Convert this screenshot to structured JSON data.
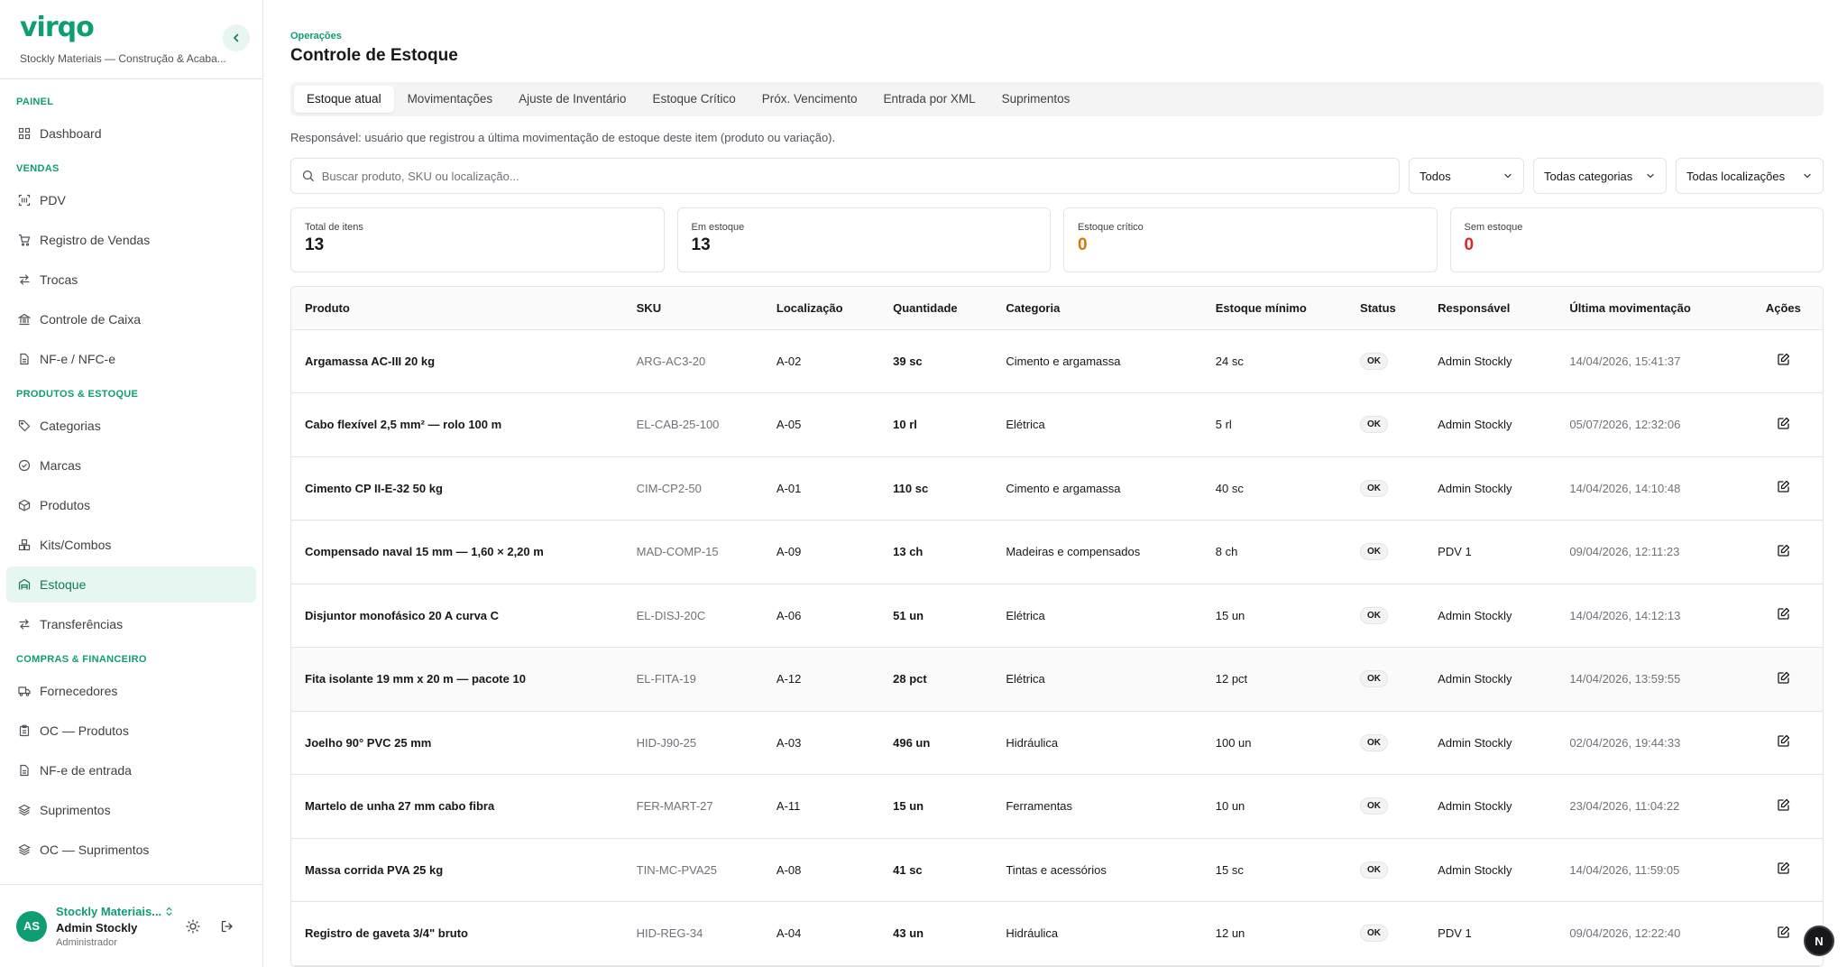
{
  "brand": {
    "logo": "virqo",
    "company": "Stockly Materiais — Construção & Acaba..."
  },
  "sidebar": {
    "groups": [
      {
        "title": "PAINEL",
        "items": [
          {
            "label": "Dashboard",
            "icon": "grid-icon"
          }
        ]
      },
      {
        "title": "VENDAS",
        "items": [
          {
            "label": "PDV",
            "icon": "scan-icon"
          },
          {
            "label": "Registro de Vendas",
            "icon": "cart-icon"
          },
          {
            "label": "Trocas",
            "icon": "swap-icon"
          },
          {
            "label": "Controle de Caixa",
            "icon": "bank-icon"
          },
          {
            "label": "NF-e / NFC-e",
            "icon": "file-icon"
          }
        ]
      },
      {
        "title": "PRODUTOS & ESTOQUE",
        "items": [
          {
            "label": "Categorias",
            "icon": "tag-icon"
          },
          {
            "label": "Marcas",
            "icon": "badge-check-icon"
          },
          {
            "label": "Produtos",
            "icon": "package-icon"
          },
          {
            "label": "Kits/Combos",
            "icon": "boxes-icon"
          },
          {
            "label": "Estoque",
            "icon": "warehouse-icon",
            "active": true
          },
          {
            "label": "Transferências",
            "icon": "swap-icon"
          }
        ]
      },
      {
        "title": "COMPRAS & FINANCEIRO",
        "items": [
          {
            "label": "Fornecedores",
            "icon": "truck-icon"
          },
          {
            "label": "OC — Produtos",
            "icon": "clipboard-icon"
          },
          {
            "label": "NF-e de entrada",
            "icon": "file-icon"
          },
          {
            "label": "Suprimentos",
            "icon": "layers-icon"
          },
          {
            "label": "OC — Suprimentos",
            "icon": "layers-icon"
          }
        ]
      }
    ]
  },
  "user": {
    "initials": "AS",
    "company": "Stockly Materiais...",
    "name": "Admin Stockly",
    "role": "Administrador"
  },
  "header": {
    "eyebrow": "Operações",
    "title": "Controle de Estoque"
  },
  "tabs": [
    "Estoque atual",
    "Movimentações",
    "Ajuste de Inventário",
    "Estoque Crítico",
    "Próx. Vencimento",
    "Entrada por XML",
    "Suprimentos"
  ],
  "responsible_note": "Responsável: usuário que registrou a última movimentação de estoque deste item (produto ou variação).",
  "filters": {
    "search_placeholder": "Buscar produto, SKU ou localização...",
    "status": "Todos",
    "category": "Todas categorias",
    "location": "Todas localizações"
  },
  "stats": [
    {
      "label": "Total de itens",
      "value": "13",
      "tone": "normal"
    },
    {
      "label": "Em estoque",
      "value": "13",
      "tone": "normal"
    },
    {
      "label": "Estoque crítico",
      "value": "0",
      "tone": "warn"
    },
    {
      "label": "Sem estoque",
      "value": "0",
      "tone": "danger"
    }
  ],
  "table": {
    "columns": [
      "Produto",
      "SKU",
      "Localização",
      "Quantidade",
      "Categoria",
      "Estoque mínimo",
      "Status",
      "Responsável",
      "Última movimentação",
      "Ações"
    ],
    "rows": [
      [
        "Argamassa AC-III 20 kg",
        "ARG-AC3-20",
        "A-02",
        "39 sc",
        "Cimento e argamassa",
        "24 sc",
        "OK",
        "Admin Stockly",
        "14/04/2026, 15:41:37"
      ],
      [
        "Cabo flexível 2,5 mm² — rolo 100 m",
        "EL-CAB-25-100",
        "A-05",
        "10 rl",
        "Elétrica",
        "5 rl",
        "OK",
        "Admin Stockly",
        "05/07/2026, 12:32:06"
      ],
      [
        "Cimento CP II-E-32 50 kg",
        "CIM-CP2-50",
        "A-01",
        "110 sc",
        "Cimento e argamassa",
        "40 sc",
        "OK",
        "Admin Stockly",
        "14/04/2026, 14:10:48"
      ],
      [
        "Compensado naval 15 mm — 1,60 × 2,20 m",
        "MAD-COMP-15",
        "A-09",
        "13 ch",
        "Madeiras e compensados",
        "8 ch",
        "OK",
        "PDV 1",
        "09/04/2026, 12:11:23"
      ],
      [
        "Disjuntor monofásico 20 A curva C",
        "EL-DISJ-20C",
        "A-06",
        "51 un",
        "Elétrica",
        "15 un",
        "OK",
        "Admin Stockly",
        "14/04/2026, 14:12:13"
      ],
      [
        "Fita isolante 19 mm x 20 m — pacote 10",
        "EL-FITA-19",
        "A-12",
        "28 pct",
        "Elétrica",
        "12 pct",
        "OK",
        "Admin Stockly",
        "14/04/2026, 13:59:55"
      ],
      [
        "Joelho 90° PVC 25 mm",
        "HID-J90-25",
        "A-03",
        "496 un",
        "Hidráulica",
        "100 un",
        "OK",
        "Admin Stockly",
        "02/04/2026, 19:44:33"
      ],
      [
        "Martelo de unha 27 mm cabo fibra",
        "FER-MART-27",
        "A-11",
        "15 un",
        "Ferramentas",
        "10 un",
        "OK",
        "Admin Stockly",
        "23/04/2026, 11:04:22"
      ],
      [
        "Massa corrida PVA 25 kg",
        "TIN-MC-PVA25",
        "A-08",
        "41 sc",
        "Tintas e acessórios",
        "15 sc",
        "OK",
        "Admin Stockly",
        "14/04/2026, 11:59:05"
      ],
      [
        "Registro de gaveta 3/4\" bruto",
        "HID-REG-34",
        "A-04",
        "43 un",
        "Hidráulica",
        "12 un",
        "OK",
        "PDV 1",
        "09/04/2026, 12:22:40"
      ]
    ]
  },
  "floating_badge": "N",
  "colors": {
    "accent": "#0f9d74",
    "warn": "#d97706",
    "danger": "#dc2626"
  }
}
